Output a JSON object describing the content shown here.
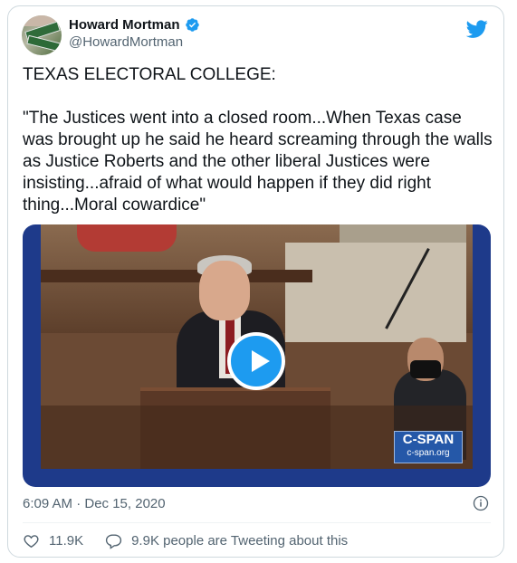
{
  "author": {
    "display_name": "Howard Mortman",
    "handle": "@HowardMortman",
    "verified": true
  },
  "tweet": {
    "text_line1": "TEXAS ELECTORAL COLLEGE:",
    "text_quote": "\"The Justices went into a closed room...When Texas case was brought up he said he heard screaming through the walls as Justice Roberts and the other liberal Justices were insisting...afraid of what would happen if they did right thing...Moral cowardice\"",
    "timestamp": "6:09 AM · Dec 15, 2020"
  },
  "media": {
    "watermark_line1": "C-SPAN",
    "watermark_line2": "c-span.org"
  },
  "actions": {
    "likes": "11.9K",
    "conversation": "9.9K people are Tweeting about this"
  },
  "colors": {
    "accent": "#1d9bf0",
    "secondary_text": "#536471"
  },
  "icons": [
    "verified-badge-icon",
    "twitter-bird-icon",
    "play-icon",
    "info-icon",
    "heart-icon",
    "comment-icon"
  ]
}
